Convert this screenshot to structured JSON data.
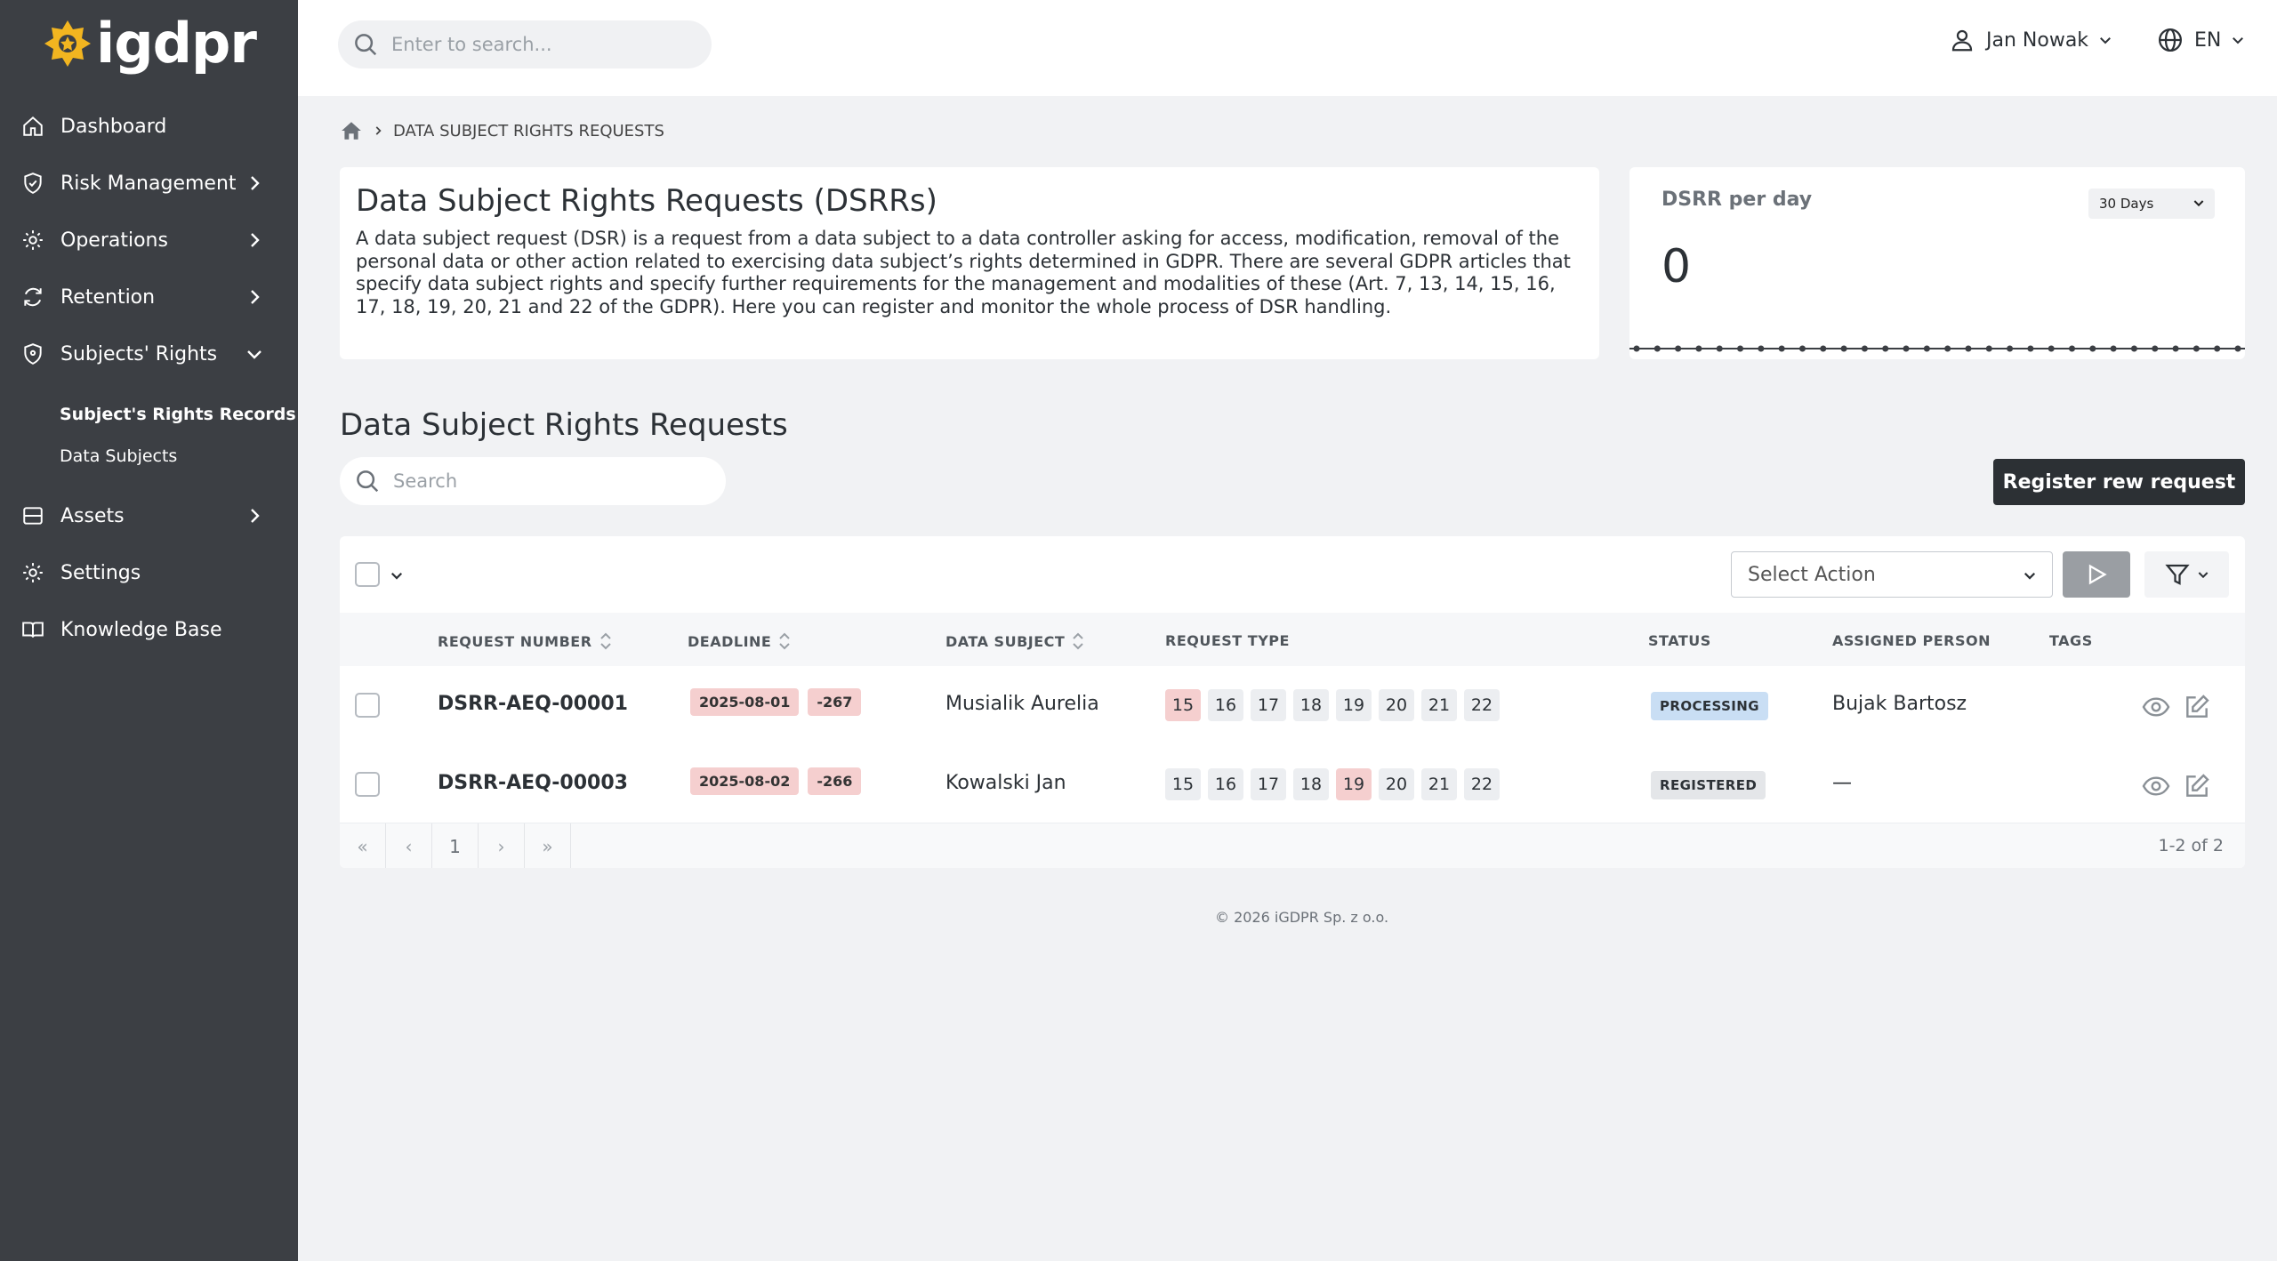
{
  "brand": {
    "logo_text": "igdpr",
    "accent": "#f2b520"
  },
  "sidebar": {
    "items": [
      {
        "label": "Dashboard",
        "icon": "home-icon",
        "has_chevron": false
      },
      {
        "label": "Risk Management",
        "icon": "shield-icon",
        "has_chevron": true
      },
      {
        "label": "Operations",
        "icon": "gear-icon",
        "has_chevron": true
      },
      {
        "label": "Retention",
        "icon": "refresh-icon",
        "has_chevron": true
      },
      {
        "label": "Subjects' Rights",
        "icon": "shield-icon",
        "has_chevron": true,
        "expanded": true
      },
      {
        "label": "Assets",
        "icon": "database-icon",
        "has_chevron": true
      },
      {
        "label": "Settings",
        "icon": "gear-icon",
        "has_chevron": false
      },
      {
        "label": "Knowledge Base",
        "icon": "book-icon",
        "has_chevron": false
      }
    ],
    "sub_items": [
      {
        "label": "Subject's Rights Records",
        "active": true
      },
      {
        "label": "Data Subjects",
        "active": false
      }
    ]
  },
  "header": {
    "search_placeholder": "Enter to search...",
    "user_name": "Jan Nowak",
    "language": "EN"
  },
  "breadcrumb": {
    "current": "DATA SUBJECT RIGHTS REQUESTS"
  },
  "info": {
    "title": "Data Subject Rights Requests (DSRRs)",
    "text": "A data subject request (DSR) is a request from a data subject to a data controller asking for access, modification, removal of the personal data or other action related to exercising data subject’s rights determined in GDPR. There are several GDPR articles that specify data subject rights and specify further requirements for the management and modalities of these (Art. 7, 13, 14, 15, 16, 17, 18, 19, 20, 21 and 22 of the GDPR). Here you can register and monitor the whole process of DSR handling."
  },
  "stats": {
    "title": "DSRR per day",
    "period": "30 Days",
    "value": "0"
  },
  "section": {
    "title": "Data Subject Rights Requests",
    "search_placeholder": "Search",
    "register_label": "Register rew request"
  },
  "toolbar": {
    "select_action_placeholder": "Select Action"
  },
  "table": {
    "columns": {
      "request_number": "REQUEST NUMBER",
      "deadline": "DEADLINE",
      "data_subject": "DATA SUBJECT",
      "request_type": "REQUEST TYPE",
      "status": "STATUS",
      "assigned_person": "ASSIGNED PERSON",
      "tags": "TAGS"
    },
    "rows": [
      {
        "request_number": "DSRR-AEQ-00001",
        "deadline": "2025-08-01",
        "days": "-267",
        "data_subject": "Musialik Aurelia",
        "articles": [
          "15",
          "16",
          "17",
          "18",
          "19",
          "20",
          "21",
          "22"
        ],
        "highlighted": "15",
        "status": "PROCESSING",
        "assigned_person": "Bujak Bartosz"
      },
      {
        "request_number": "DSRR-AEQ-00003",
        "deadline": "2025-08-02",
        "days": "-266",
        "data_subject": "Kowalski Jan",
        "articles": [
          "15",
          "16",
          "17",
          "18",
          "19",
          "20",
          "21",
          "22"
        ],
        "highlighted": "19",
        "status": "REGISTERED",
        "assigned_person": "—"
      }
    ]
  },
  "pager": {
    "first": "«",
    "prev": "‹",
    "page": "1",
    "next": "›",
    "last": "»",
    "info": "1-2 of 2"
  },
  "footer": {
    "text": "© 2026 iGDPR Sp. z o.o."
  }
}
